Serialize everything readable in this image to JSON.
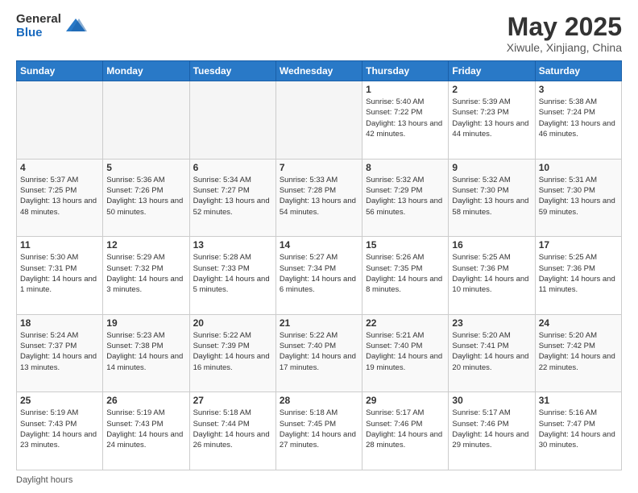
{
  "header": {
    "logo_general": "General",
    "logo_blue": "Blue",
    "month_title": "May 2025",
    "location": "Xiwule, Xinjiang, China"
  },
  "days_of_week": [
    "Sunday",
    "Monday",
    "Tuesday",
    "Wednesday",
    "Thursday",
    "Friday",
    "Saturday"
  ],
  "footer_text": "Daylight hours",
  "weeks": [
    [
      {
        "day": "",
        "sunrise": "",
        "sunset": "",
        "daylight": "",
        "empty": true
      },
      {
        "day": "",
        "sunrise": "",
        "sunset": "",
        "daylight": "",
        "empty": true
      },
      {
        "day": "",
        "sunrise": "",
        "sunset": "",
        "daylight": "",
        "empty": true
      },
      {
        "day": "",
        "sunrise": "",
        "sunset": "",
        "daylight": "",
        "empty": true
      },
      {
        "day": "1",
        "sunrise": "Sunrise: 5:40 AM",
        "sunset": "Sunset: 7:22 PM",
        "daylight": "Daylight: 13 hours and 42 minutes.",
        "empty": false
      },
      {
        "day": "2",
        "sunrise": "Sunrise: 5:39 AM",
        "sunset": "Sunset: 7:23 PM",
        "daylight": "Daylight: 13 hours and 44 minutes.",
        "empty": false
      },
      {
        "day": "3",
        "sunrise": "Sunrise: 5:38 AM",
        "sunset": "Sunset: 7:24 PM",
        "daylight": "Daylight: 13 hours and 46 minutes.",
        "empty": false
      }
    ],
    [
      {
        "day": "4",
        "sunrise": "Sunrise: 5:37 AM",
        "sunset": "Sunset: 7:25 PM",
        "daylight": "Daylight: 13 hours and 48 minutes.",
        "empty": false
      },
      {
        "day": "5",
        "sunrise": "Sunrise: 5:36 AM",
        "sunset": "Sunset: 7:26 PM",
        "daylight": "Daylight: 13 hours and 50 minutes.",
        "empty": false
      },
      {
        "day": "6",
        "sunrise": "Sunrise: 5:34 AM",
        "sunset": "Sunset: 7:27 PM",
        "daylight": "Daylight: 13 hours and 52 minutes.",
        "empty": false
      },
      {
        "day": "7",
        "sunrise": "Sunrise: 5:33 AM",
        "sunset": "Sunset: 7:28 PM",
        "daylight": "Daylight: 13 hours and 54 minutes.",
        "empty": false
      },
      {
        "day": "8",
        "sunrise": "Sunrise: 5:32 AM",
        "sunset": "Sunset: 7:29 PM",
        "daylight": "Daylight: 13 hours and 56 minutes.",
        "empty": false
      },
      {
        "day": "9",
        "sunrise": "Sunrise: 5:32 AM",
        "sunset": "Sunset: 7:30 PM",
        "daylight": "Daylight: 13 hours and 58 minutes.",
        "empty": false
      },
      {
        "day": "10",
        "sunrise": "Sunrise: 5:31 AM",
        "sunset": "Sunset: 7:30 PM",
        "daylight": "Daylight: 13 hours and 59 minutes.",
        "empty": false
      }
    ],
    [
      {
        "day": "11",
        "sunrise": "Sunrise: 5:30 AM",
        "sunset": "Sunset: 7:31 PM",
        "daylight": "Daylight: 14 hours and 1 minute.",
        "empty": false
      },
      {
        "day": "12",
        "sunrise": "Sunrise: 5:29 AM",
        "sunset": "Sunset: 7:32 PM",
        "daylight": "Daylight: 14 hours and 3 minutes.",
        "empty": false
      },
      {
        "day": "13",
        "sunrise": "Sunrise: 5:28 AM",
        "sunset": "Sunset: 7:33 PM",
        "daylight": "Daylight: 14 hours and 5 minutes.",
        "empty": false
      },
      {
        "day": "14",
        "sunrise": "Sunrise: 5:27 AM",
        "sunset": "Sunset: 7:34 PM",
        "daylight": "Daylight: 14 hours and 6 minutes.",
        "empty": false
      },
      {
        "day": "15",
        "sunrise": "Sunrise: 5:26 AM",
        "sunset": "Sunset: 7:35 PM",
        "daylight": "Daylight: 14 hours and 8 minutes.",
        "empty": false
      },
      {
        "day": "16",
        "sunrise": "Sunrise: 5:25 AM",
        "sunset": "Sunset: 7:36 PM",
        "daylight": "Daylight: 14 hours and 10 minutes.",
        "empty": false
      },
      {
        "day": "17",
        "sunrise": "Sunrise: 5:25 AM",
        "sunset": "Sunset: 7:36 PM",
        "daylight": "Daylight: 14 hours and 11 minutes.",
        "empty": false
      }
    ],
    [
      {
        "day": "18",
        "sunrise": "Sunrise: 5:24 AM",
        "sunset": "Sunset: 7:37 PM",
        "daylight": "Daylight: 14 hours and 13 minutes.",
        "empty": false
      },
      {
        "day": "19",
        "sunrise": "Sunrise: 5:23 AM",
        "sunset": "Sunset: 7:38 PM",
        "daylight": "Daylight: 14 hours and 14 minutes.",
        "empty": false
      },
      {
        "day": "20",
        "sunrise": "Sunrise: 5:22 AM",
        "sunset": "Sunset: 7:39 PM",
        "daylight": "Daylight: 14 hours and 16 minutes.",
        "empty": false
      },
      {
        "day": "21",
        "sunrise": "Sunrise: 5:22 AM",
        "sunset": "Sunset: 7:40 PM",
        "daylight": "Daylight: 14 hours and 17 minutes.",
        "empty": false
      },
      {
        "day": "22",
        "sunrise": "Sunrise: 5:21 AM",
        "sunset": "Sunset: 7:40 PM",
        "daylight": "Daylight: 14 hours and 19 minutes.",
        "empty": false
      },
      {
        "day": "23",
        "sunrise": "Sunrise: 5:20 AM",
        "sunset": "Sunset: 7:41 PM",
        "daylight": "Daylight: 14 hours and 20 minutes.",
        "empty": false
      },
      {
        "day": "24",
        "sunrise": "Sunrise: 5:20 AM",
        "sunset": "Sunset: 7:42 PM",
        "daylight": "Daylight: 14 hours and 22 minutes.",
        "empty": false
      }
    ],
    [
      {
        "day": "25",
        "sunrise": "Sunrise: 5:19 AM",
        "sunset": "Sunset: 7:43 PM",
        "daylight": "Daylight: 14 hours and 23 minutes.",
        "empty": false
      },
      {
        "day": "26",
        "sunrise": "Sunrise: 5:19 AM",
        "sunset": "Sunset: 7:43 PM",
        "daylight": "Daylight: 14 hours and 24 minutes.",
        "empty": false
      },
      {
        "day": "27",
        "sunrise": "Sunrise: 5:18 AM",
        "sunset": "Sunset: 7:44 PM",
        "daylight": "Daylight: 14 hours and 26 minutes.",
        "empty": false
      },
      {
        "day": "28",
        "sunrise": "Sunrise: 5:18 AM",
        "sunset": "Sunset: 7:45 PM",
        "daylight": "Daylight: 14 hours and 27 minutes.",
        "empty": false
      },
      {
        "day": "29",
        "sunrise": "Sunrise: 5:17 AM",
        "sunset": "Sunset: 7:46 PM",
        "daylight": "Daylight: 14 hours and 28 minutes.",
        "empty": false
      },
      {
        "day": "30",
        "sunrise": "Sunrise: 5:17 AM",
        "sunset": "Sunset: 7:46 PM",
        "daylight": "Daylight: 14 hours and 29 minutes.",
        "empty": false
      },
      {
        "day": "31",
        "sunrise": "Sunrise: 5:16 AM",
        "sunset": "Sunset: 7:47 PM",
        "daylight": "Daylight: 14 hours and 30 minutes.",
        "empty": false
      }
    ]
  ]
}
